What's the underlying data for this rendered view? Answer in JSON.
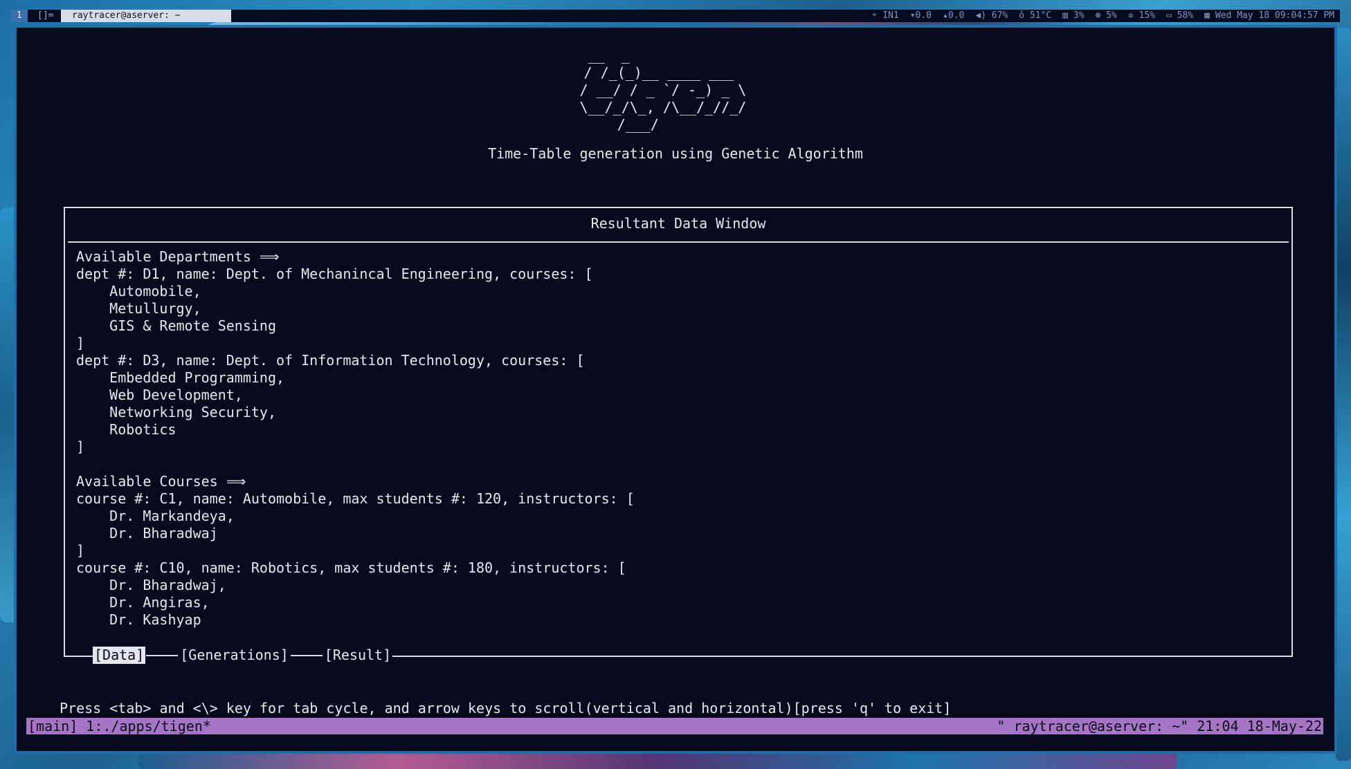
{
  "topbar": {
    "workspace": "1",
    "layout": "[]=",
    "window_title": "raytracer@aserver: ~",
    "stats": [
      {
        "icon": "wifi-icon",
        "text": "IN1"
      },
      {
        "icon": "download-icon",
        "text": "▾0.0"
      },
      {
        "icon": "upload-icon",
        "text": "▴0.0"
      },
      {
        "icon": "volume-icon",
        "text": "67%"
      },
      {
        "icon": "thermometer-icon",
        "text": "51°C"
      },
      {
        "icon": "memory-icon",
        "text": "3%"
      },
      {
        "icon": "cpu-icon",
        "text": "5%"
      },
      {
        "icon": "gear-icon",
        "text": "15%"
      },
      {
        "icon": "battery-icon",
        "text": "58%"
      },
      {
        "icon": "calendar-icon",
        "text": "Wed May 18 09:04:57 PM"
      }
    ]
  },
  "app": {
    "logo_ascii": "  __  _                  \n / /_(_)__ ____ ___     \n/ __/ / _ `/ -_) _ \\   \n\\__/_/\\_, /\\__/_//_/   \n     /___/              ",
    "subtitle": "Time-Table generation using Genetic Algorithm",
    "panel_title": "Resultant Data Window",
    "content_lines": [
      "Available Departments ⟹",
      "dept #: D1, name: Dept. of Mechanincal Engineering, courses: [",
      "    Automobile,",
      "    Metullurgy,",
      "    GIS & Remote Sensing",
      "]",
      "dept #: D3, name: Dept. of Information Technology, courses: [",
      "    Embedded Programming,",
      "    Web Development,",
      "    Networking Security,",
      "    Robotics",
      "]",
      "",
      "Available Courses ⟹",
      "course #: C1, name: Automobile, max students #: 120, instructors: [",
      "    Dr. Markandeya,",
      "    Dr. Bharadwaj",
      "]",
      "course #: C10, name: Robotics, max students #: 180, instructors: [",
      "    Dr. Bharadwaj,",
      "    Dr. Angiras,",
      "    Dr. Kashyap"
    ],
    "tabs": [
      {
        "label": "[Data]",
        "active": true
      },
      {
        "label": "[Generations]",
        "active": false
      },
      {
        "label": "[Result]",
        "active": false
      }
    ],
    "hint": "Press <tab> and <\\> key for tab cycle, and arrow keys to scroll(vertical and horizontal)[press 'q' to exit]"
  },
  "tmux": {
    "left": "[main] 1:./apps/tigen*",
    "right": "\" raytracer@aserver: ~\" 21:04 18-May-22"
  },
  "colors": {
    "terminal_bg": "#070a1c",
    "text": "#e6e8ef",
    "tmux_bar": "#a674c4",
    "active_tab_bg": "#e4e6ec"
  }
}
